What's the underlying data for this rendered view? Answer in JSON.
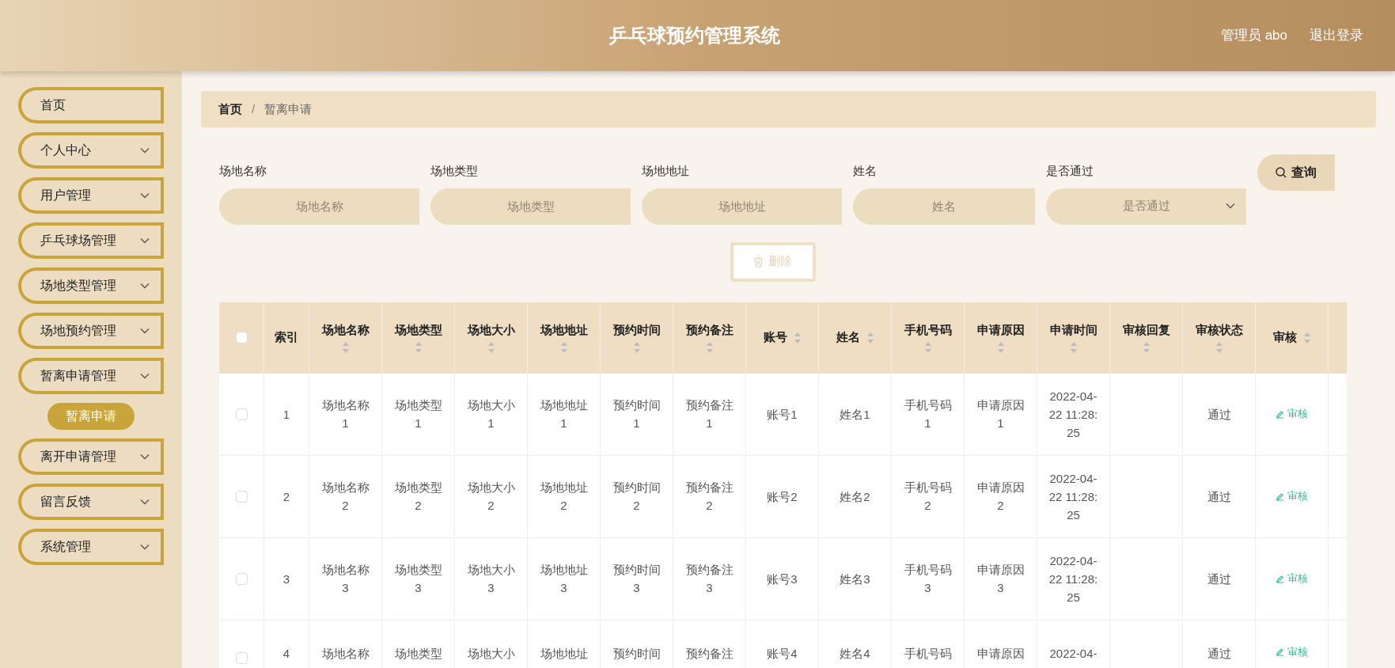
{
  "header": {
    "title": "乒乓球预约管理系统",
    "user": "管理员 abo",
    "logout": "退出登录"
  },
  "sidebar": {
    "items": [
      {
        "label": "首页",
        "kind": "link"
      },
      {
        "label": "个人中心",
        "kind": "menu"
      },
      {
        "label": "用户管理",
        "kind": "menu"
      },
      {
        "label": "乒乓球场管理",
        "kind": "menu"
      },
      {
        "label": "场地类型管理",
        "kind": "menu"
      },
      {
        "label": "场地预约管理",
        "kind": "menu"
      },
      {
        "label": "暂离申请管理",
        "kind": "menu",
        "children": [
          {
            "label": "暂离申请",
            "selected": true
          }
        ]
      },
      {
        "label": "离开申请管理",
        "kind": "menu"
      },
      {
        "label": "留言反馈",
        "kind": "menu"
      },
      {
        "label": "系统管理",
        "kind": "menu"
      }
    ]
  },
  "breadcrumb": {
    "separator": "/",
    "items": [
      "首页",
      "暂离申请"
    ]
  },
  "filters": [
    {
      "label": "场地名称",
      "placeholder": "场地名称",
      "kind": "text"
    },
    {
      "label": "场地类型",
      "placeholder": "场地类型",
      "kind": "text"
    },
    {
      "label": "场地地址",
      "placeholder": "场地地址",
      "kind": "text"
    },
    {
      "label": "姓名",
      "placeholder": "姓名",
      "kind": "text"
    },
    {
      "label": "是否通过",
      "placeholder": "是否通过",
      "kind": "select"
    }
  ],
  "search_button": "查询",
  "delete_button": {
    "label": "删除",
    "disabled": true
  },
  "table": {
    "select_all": {
      "checked": false
    },
    "columns": [
      {
        "label": "索引",
        "sortable": false
      },
      {
        "label": "场地名称",
        "sortable": true
      },
      {
        "label": "场地类型",
        "sortable": true
      },
      {
        "label": "场地大小",
        "sortable": true
      },
      {
        "label": "场地地址",
        "sortable": true
      },
      {
        "label": "预约时间",
        "sortable": true
      },
      {
        "label": "预约备注",
        "sortable": true
      },
      {
        "label": "账号",
        "sortable": true
      },
      {
        "label": "姓名",
        "sortable": true
      },
      {
        "label": "手机号码",
        "sortable": true
      },
      {
        "label": "申请原因",
        "sortable": true
      },
      {
        "label": "申请时间",
        "sortable": true
      },
      {
        "label": "审核回复",
        "sortable": true
      },
      {
        "label": "审核状态",
        "sortable": true
      },
      {
        "label": "审核",
        "sortable": true
      }
    ],
    "rows": [
      {
        "checked": false,
        "cells": [
          "1",
          "场地名称1",
          "场地类型1",
          "场地大小1",
          "场地地址1",
          "预约时间1",
          "预约备注1",
          "账号1",
          "姓名1",
          "手机号码1",
          "申请原因1",
          "2022-04-22 11:28:25",
          "",
          "通过"
        ],
        "action": "审核"
      },
      {
        "checked": false,
        "cells": [
          "2",
          "场地名称2",
          "场地类型2",
          "场地大小2",
          "场地地址2",
          "预约时间2",
          "预约备注2",
          "账号2",
          "姓名2",
          "手机号码2",
          "申请原因2",
          "2022-04-22 11:28:25",
          "",
          "通过"
        ],
        "action": "审核"
      },
      {
        "checked": false,
        "cells": [
          "3",
          "场地名称3",
          "场地类型3",
          "场地大小3",
          "场地地址3",
          "预约时间3",
          "预约备注3",
          "账号3",
          "姓名3",
          "手机号码3",
          "申请原因3",
          "2022-04-22 11:28:25",
          "",
          "通过"
        ],
        "action": "审核"
      },
      {
        "checked": false,
        "cells": [
          "4",
          "场地名称",
          "场地类型",
          "场地大小",
          "场地地址",
          "预约时间",
          "预约备注",
          "账号4",
          "姓名4",
          "手机号码",
          "申请原因",
          "2022-04-",
          "",
          "通过"
        ],
        "action": "审核"
      }
    ]
  }
}
